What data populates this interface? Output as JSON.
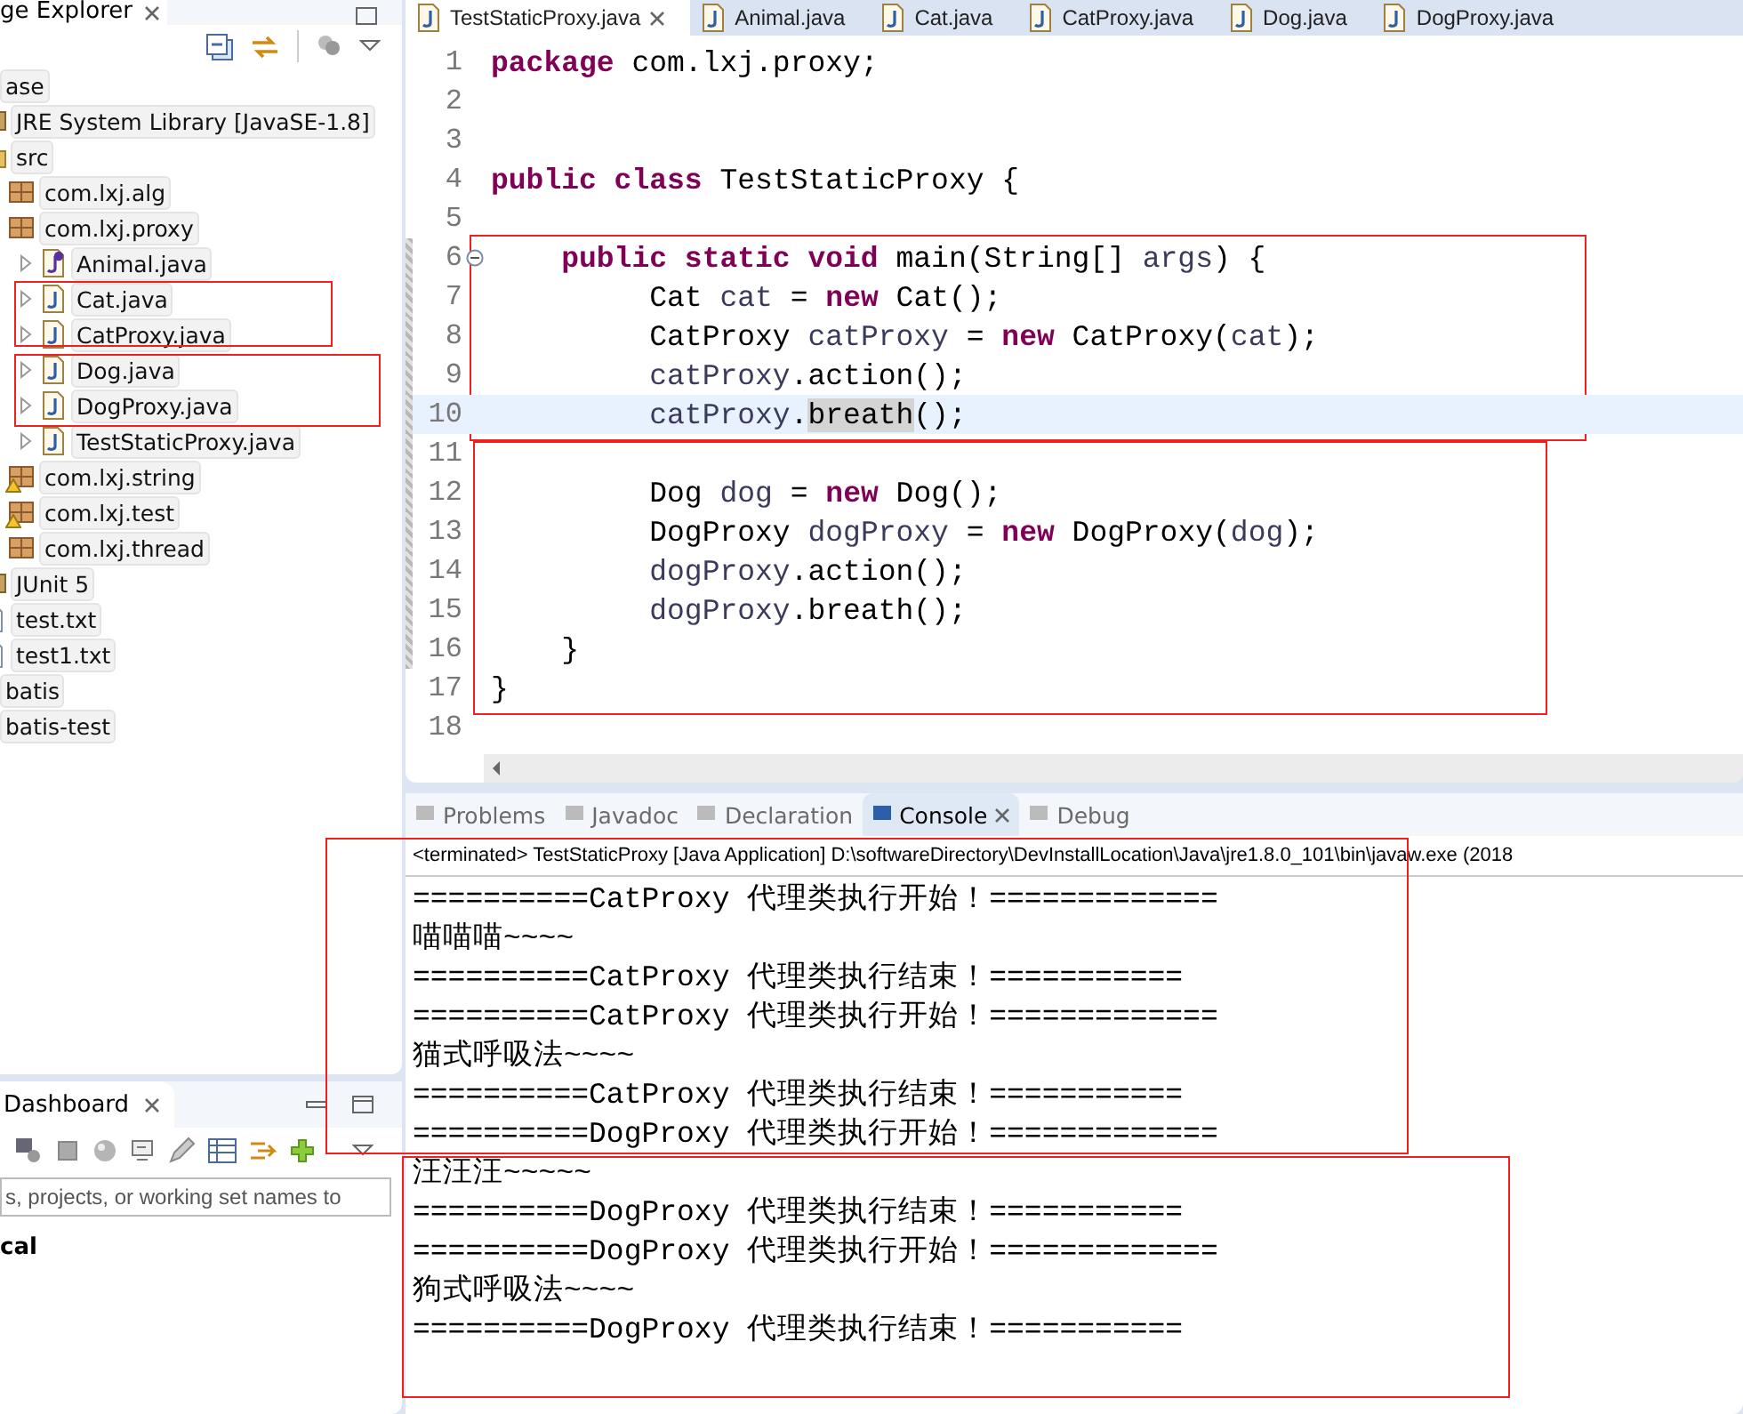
{
  "explorer": {
    "title": "ge Explorer",
    "items": [
      {
        "label": "ase",
        "children": [
          {
            "label": "JRE System Library [JavaSE-1.8]",
            "kind": "library"
          },
          {
            "label": "src",
            "kind": "folder",
            "children": [
              {
                "label": "com.lxj.alg",
                "kind": "package",
                "warning": false
              },
              {
                "label": "com.lxj.proxy",
                "kind": "package",
                "warning": false,
                "children": [
                  {
                    "label": "Animal.java",
                    "kind": "interface"
                  },
                  {
                    "label": "Cat.java",
                    "kind": "class"
                  },
                  {
                    "label": "CatProxy.java",
                    "kind": "class"
                  },
                  {
                    "label": "Dog.java",
                    "kind": "class"
                  },
                  {
                    "label": "DogProxy.java",
                    "kind": "class"
                  },
                  {
                    "label": "TestStaticProxy.java",
                    "kind": "class"
                  }
                ]
              },
              {
                "label": "com.lxj.string",
                "kind": "package",
                "warning": true
              },
              {
                "label": "com.lxj.test",
                "kind": "package",
                "warning": true
              },
              {
                "label": "com.lxj.thread",
                "kind": "package",
                "warning": false
              }
            ]
          },
          {
            "label": "JUnit 5",
            "kind": "library"
          },
          {
            "label": "test.txt",
            "kind": "text"
          },
          {
            "label": "test1.txt",
            "kind": "text"
          }
        ]
      },
      {
        "label": "batis"
      },
      {
        "label": "batis-test"
      }
    ]
  },
  "dashboard": {
    "title": "Dashboard",
    "search": {
      "placeholder": "s, projects, or working set names to"
    },
    "heading": "cal"
  },
  "editor": {
    "tabs": [
      {
        "label": "TestStaticProxy.java",
        "selected": true
      },
      {
        "label": "Animal.java",
        "selected": false
      },
      {
        "label": "Cat.java",
        "selected": false
      },
      {
        "label": "CatProxy.java",
        "selected": false
      },
      {
        "label": "Dog.java",
        "selected": false
      },
      {
        "label": "DogProxy.java",
        "selected": false
      }
    ],
    "lines": [
      {
        "number": "1",
        "current": false,
        "changed": false,
        "fold": false,
        "tokens": [
          {
            "text": "package",
            "kind": "keyword"
          },
          {
            "text": " com.lxj.proxy;",
            "kind": "plain"
          }
        ]
      },
      {
        "number": "2",
        "current": false,
        "changed": false,
        "fold": false
      },
      {
        "number": "3",
        "current": false,
        "changed": false,
        "fold": false
      },
      {
        "number": "4",
        "current": false,
        "changed": false,
        "fold": false,
        "tokens": [
          {
            "text": "public class",
            "kind": "keyword"
          },
          {
            "text": " TestStaticProxy {",
            "kind": "plain"
          }
        ]
      },
      {
        "number": "5",
        "current": false,
        "changed": false,
        "fold": false
      },
      {
        "number": "6",
        "current": false,
        "changed": true,
        "fold": true,
        "tokens": [
          {
            "text": "    public static void",
            "kind": "keyword"
          },
          {
            "text": " main(String[] ",
            "kind": "plain"
          },
          {
            "text": "args",
            "kind": "variable"
          },
          {
            "text": ") {",
            "kind": "plain"
          }
        ]
      },
      {
        "number": "7",
        "current": false,
        "changed": true,
        "fold": false,
        "tokens": [
          {
            "text": "         Cat ",
            "kind": "plain"
          },
          {
            "text": "cat",
            "kind": "variable"
          },
          {
            "text": " = ",
            "kind": "plain"
          },
          {
            "text": "new",
            "kind": "keyword"
          },
          {
            "text": " Cat();",
            "kind": "plain"
          }
        ]
      },
      {
        "number": "8",
        "current": false,
        "changed": true,
        "fold": false,
        "tokens": [
          {
            "text": "         CatProxy ",
            "kind": "plain"
          },
          {
            "text": "catProxy",
            "kind": "variable"
          },
          {
            "text": " = ",
            "kind": "plain"
          },
          {
            "text": "new",
            "kind": "keyword"
          },
          {
            "text": " CatProxy(",
            "kind": "plain"
          },
          {
            "text": "cat",
            "kind": "variable"
          },
          {
            "text": ");",
            "kind": "plain"
          }
        ]
      },
      {
        "number": "9",
        "current": false,
        "changed": true,
        "fold": false,
        "tokens": [
          {
            "text": "         catProxy",
            "kind": "variable"
          },
          {
            "text": ".action();",
            "kind": "plain"
          }
        ]
      },
      {
        "number": "10",
        "current": true,
        "changed": true,
        "fold": false,
        "tokens": [
          {
            "text": "         catProxy",
            "kind": "variable"
          },
          {
            "text": ".",
            "kind": "plain"
          },
          {
            "text": "breath",
            "kind": "occurrence"
          },
          {
            "text": "();",
            "kind": "plain"
          }
        ]
      },
      {
        "number": "11",
        "current": false,
        "changed": true,
        "fold": false
      },
      {
        "number": "12",
        "current": false,
        "changed": true,
        "fold": false,
        "tokens": [
          {
            "text": "         Dog ",
            "kind": "plain"
          },
          {
            "text": "dog",
            "kind": "variable"
          },
          {
            "text": " = ",
            "kind": "plain"
          },
          {
            "text": "new",
            "kind": "keyword"
          },
          {
            "text": " Dog();",
            "kind": "plain"
          }
        ]
      },
      {
        "number": "13",
        "current": false,
        "changed": true,
        "fold": false,
        "tokens": [
          {
            "text": "         DogProxy ",
            "kind": "plain"
          },
          {
            "text": "dogProxy",
            "kind": "variable"
          },
          {
            "text": " = ",
            "kind": "plain"
          },
          {
            "text": "new",
            "kind": "keyword"
          },
          {
            "text": " DogProxy(",
            "kind": "plain"
          },
          {
            "text": "dog",
            "kind": "variable"
          },
          {
            "text": ");",
            "kind": "plain"
          }
        ]
      },
      {
        "number": "14",
        "current": false,
        "changed": true,
        "fold": false,
        "tokens": [
          {
            "text": "         dogProxy",
            "kind": "variable"
          },
          {
            "text": ".action();",
            "kind": "plain"
          }
        ]
      },
      {
        "number": "15",
        "current": false,
        "changed": true,
        "fold": false,
        "tokens": [
          {
            "text": "         dogProxy",
            "kind": "variable"
          },
          {
            "text": ".breath();",
            "kind": "plain"
          }
        ]
      },
      {
        "number": "16",
        "current": false,
        "changed": true,
        "fold": false,
        "tokens": [
          {
            "text": "    }",
            "kind": "plain"
          }
        ]
      },
      {
        "number": "17",
        "current": false,
        "changed": false,
        "fold": false,
        "tokens": [
          {
            "text": "}",
            "kind": "plain"
          }
        ]
      },
      {
        "number": "18",
        "current": false,
        "changed": false,
        "fold": false
      }
    ]
  },
  "console": {
    "tabs": [
      {
        "label": "Problems",
        "selected": false
      },
      {
        "label": "Javadoc",
        "selected": false
      },
      {
        "label": "Declaration",
        "selected": false
      },
      {
        "label": "Console",
        "selected": true
      },
      {
        "label": "Debug",
        "selected": false
      }
    ],
    "header": "<terminated> TestStaticProxy [Java Application] D:\\softwareDirectory\\DevInstallLocation\\Java\\jre1.8.0_101\\bin\\javaw.exe (2018",
    "output": [
      "==========CatProxy 代理类执行开始！=============",
      "喵喵喵~~~~",
      "==========CatProxy 代理类执行结束！===========",
      "==========CatProxy 代理类执行开始！=============",
      "猫式呼吸法~~~~",
      "==========CatProxy 代理类执行结束！===========",
      "==========DogProxy 代理类执行开始！=============",
      "汪汪汪~~~~~",
      "==========DogProxy 代理类执行结束！===========",
      "==========DogProxy 代理类执行开始！=============",
      "狗式呼吸法~~~~",
      "==========DogProxy 代理类执行结束！==========="
    ]
  }
}
